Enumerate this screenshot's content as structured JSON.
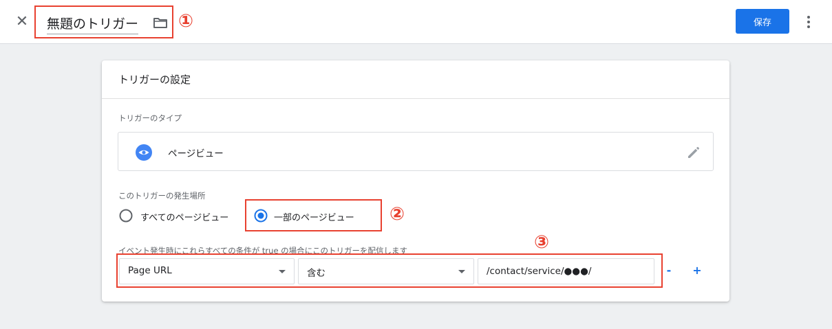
{
  "header": {
    "close_symbol": "✕",
    "trigger_name": "無題のトリガー",
    "save_label": "保存"
  },
  "annotations": {
    "marker_1": "①",
    "marker_2": "②",
    "marker_3": "③"
  },
  "card": {
    "title": "トリガーの設定",
    "trigger_type_label": "トリガーのタイプ",
    "trigger_type_value": "ページビュー",
    "fires_on_label": "このトリガーの発生場所",
    "fires_on_options": [
      {
        "label": "すべてのページビュー",
        "selected": false
      },
      {
        "label": "一部のページビュー",
        "selected": true
      }
    ],
    "condition_label": "イベント発生時にこれらすべての条件が true の場合にこのトリガーを配信します",
    "condition": {
      "variable": "Page URL",
      "operator": "含む",
      "value": "/contact/service/●●●/"
    },
    "remove_label": "-",
    "add_label": "+"
  },
  "colors": {
    "accent": "#1a73e8",
    "annotation": "#e8402f",
    "background": "#eef0f2"
  },
  "icons": [
    "close-icon",
    "folder-icon",
    "more-vert-icon",
    "eye-icon",
    "pencil-icon",
    "dropdown-caret-icon"
  ]
}
